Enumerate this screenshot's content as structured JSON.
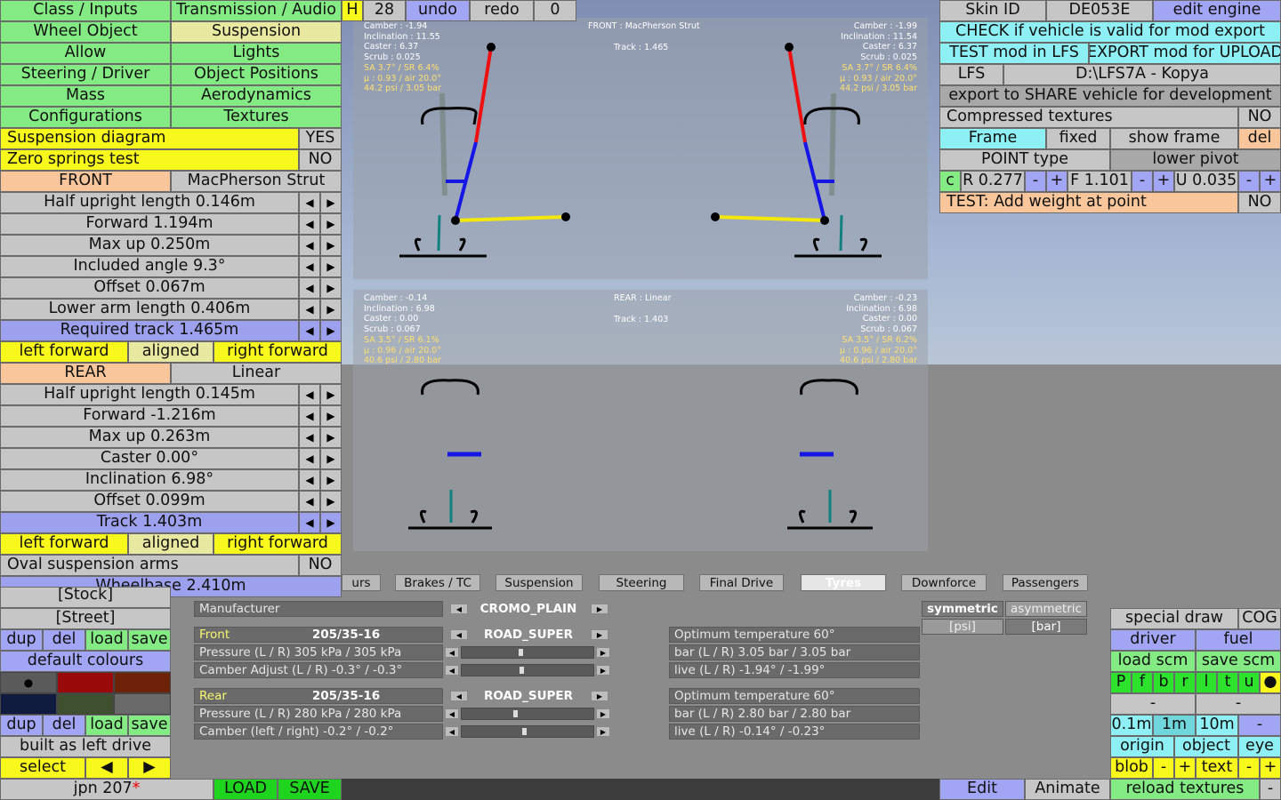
{
  "left_menu": {
    "class_inputs": "Class / Inputs",
    "transmission_audio": "Transmission / Audio",
    "h_btn": "H",
    "undo_count": "28",
    "undo": "undo",
    "redo": "redo",
    "redo_count": "0",
    "wheel_object": "Wheel Object",
    "suspension": "Suspension",
    "allow": "Allow",
    "lights": "Lights",
    "steering_driver": "Steering / Driver",
    "object_positions": "Object Positions",
    "mass": "Mass",
    "aerodynamics": "Aerodynamics",
    "configurations": "Configurations",
    "textures": "Textures"
  },
  "suspension_panel": {
    "diagram_label": "Suspension diagram",
    "diagram_value": "YES",
    "zero_springs_label": "Zero springs test",
    "zero_springs_value": "NO",
    "front_label": "FRONT",
    "front_type": "MacPherson Strut",
    "front_rows": [
      "Half upright length 0.146m",
      "Forward 1.194m",
      "Max up 0.250m",
      "Included angle 9.3°",
      "Offset 0.067m",
      "Lower arm length 0.406m",
      "Required track 1.465m"
    ],
    "left_forward": "left forward",
    "aligned": "aligned",
    "right_forward": "right forward",
    "rear_label": "REAR",
    "rear_type": "Linear",
    "rear_rows": [
      "Half upright length 0.145m",
      "Forward -1.216m",
      "Max up 0.263m",
      "Caster 0.00°",
      "Inclination 6.98°",
      "Offset 0.099m",
      "Track 1.403m"
    ],
    "oval_arms_label": "Oval suspension arms",
    "oval_arms_value": "NO",
    "wheelbase": "Wheelbase 2.410m"
  },
  "diagram_front": {
    "title": "FRONT : MacPherson Strut",
    "track": "Track : 1.465",
    "left_info": "Camber : -1.94\nInclination : 11.55\nCaster : 6.37\nScrub : 0.025",
    "left_ann": "SA 3.7° / SR 6.4%\nμ : 0.93 / air 20.0°\n44.2 psi / 3.05 bar",
    "right_info": "Camber : -1.99\nInclination : 11.54\nCaster : 6.37\nScrub : 0.025",
    "right_ann": "SA 3.7° / SR 6.4%\nμ : 0.93 / air 20.0°\n44.2 psi / 3.05 bar"
  },
  "diagram_rear": {
    "title": "REAR : Linear",
    "track": "Track : 1.403",
    "left_info": "Camber : -0.14\nInclination : 6.98\nCaster : 0.00\nScrub : 0.067",
    "left_ann": "SA 3.5° / SR 6.1%\nμ : 0.96 / air 20.0°\n40.6 psi / 2.80 bar",
    "right_info": "Camber : -0.23\nInclination : 6.98\nCaster : 0.00\nScrub : 0.067",
    "right_ann": "SA 3.5° / SR 6.2%\nμ : 0.96 / air 20.0°\n40.6 psi / 2.80 bar"
  },
  "right_panel": {
    "skin_id": "Skin ID",
    "skin_value": "DE053E",
    "edit_engine": "edit engine",
    "check_valid": "CHECK if vehicle is valid for mod export",
    "test_lfs": "TEST mod in LFS",
    "export_upload": "EXPORT mod for UPLOAD",
    "lfs": "LFS",
    "lfs_path": "D:\\LFS7A - Kopya",
    "export_share": "export to SHARE vehicle for development",
    "compressed": "Compressed textures",
    "compressed_value": "NO",
    "frame": "Frame",
    "fixed": "fixed",
    "show_frame": "show frame",
    "del": "del",
    "point_type": "POINT type",
    "lower_pivot": "lower pivot",
    "c": "c",
    "r_val": "R 0.277",
    "minus": "-",
    "plus": "+",
    "f_val": "F 1.101",
    "u_val": "U 0.035",
    "test_weight": "TEST: Add weight at point",
    "test_weight_value": "NO"
  },
  "tabs": [
    "urs",
    "Brakes / TC",
    "Suspension",
    "Steering",
    "Final Drive",
    "Tyres",
    "Downforce",
    "Passengers"
  ],
  "tyres": {
    "manufacturer_label": "Manufacturer",
    "manufacturer_value": "CROMO_PLAIN",
    "front_label": "Front",
    "front_size": "205/35-16",
    "front_type": "ROAD_SUPER",
    "front_pressure": "Pressure (L / R) 305 kPa / 305 kPa",
    "front_camber": "Camber Adjust (L / R) -0.3° / -0.3°",
    "front_opt_temp": "Optimum temperature 60°",
    "front_bar": "bar (L / R) 3.05 bar / 3.05 bar",
    "front_live": "live (L / R) -1.94° / -1.99°",
    "rear_label": "Rear",
    "rear_size": "205/35-16",
    "rear_type": "ROAD_SUPER",
    "rear_pressure": "Pressure (L / R) 280 kPa / 280 kPa",
    "rear_camber": "Camber (left / right) -0.2° / -0.2°",
    "rear_opt_temp": "Optimum temperature 60°",
    "rear_bar": "bar (L / R) 2.80 bar / 2.80 bar",
    "rear_live": "live (L / R) -0.14° / -0.23°",
    "symmetric": "symmetric",
    "asymmetric": "asymmetric",
    "psi": "[psi]",
    "bar": "[bar]",
    "front_pressure_slider": 0.44,
    "front_camber_slider": 0.45,
    "rear_pressure_slider": 0.4,
    "rear_camber_slider": 0.47
  },
  "bottom_left": {
    "stock": "[Stock]",
    "street": "[Street]",
    "dup": "dup",
    "del": "del",
    "load": "load",
    "save": "save",
    "default_colours": "default colours",
    "swatch_colors": [
      "#5a5a5a",
      "#9a0a0a",
      "#6e2208",
      "#0e1b3e",
      "#3e5030",
      "#6a6a6a"
    ],
    "built_as": "built as left drive",
    "select": "select",
    "prev": "◀",
    "next": "▶",
    "vehicle_name": "jpn 207",
    "modified_mark": "*",
    "load_btn": "LOAD",
    "save_btn": "SAVE"
  },
  "bottom_right": {
    "special_draw": "special draw",
    "cog": "COG",
    "driver": "driver",
    "fuel": "fuel",
    "load_scm": "load scm",
    "save_scm": "save scm",
    "letters": [
      "P",
      "f",
      "b",
      "r",
      "l",
      "t",
      "u",
      "●"
    ],
    "dash1": "-",
    "dash2": "-",
    "step_01": "0.1m",
    "step_1": "1m",
    "step_10": "10m",
    "step_minus": "-",
    "origin": "origin",
    "object": "object",
    "eye": "eye",
    "blob": "blob",
    "minus": "-",
    "plus": "+",
    "text": "text",
    "edit": "Edit",
    "animate": "Animate",
    "reload_textures": "reload textures",
    "end_minus": "-"
  }
}
